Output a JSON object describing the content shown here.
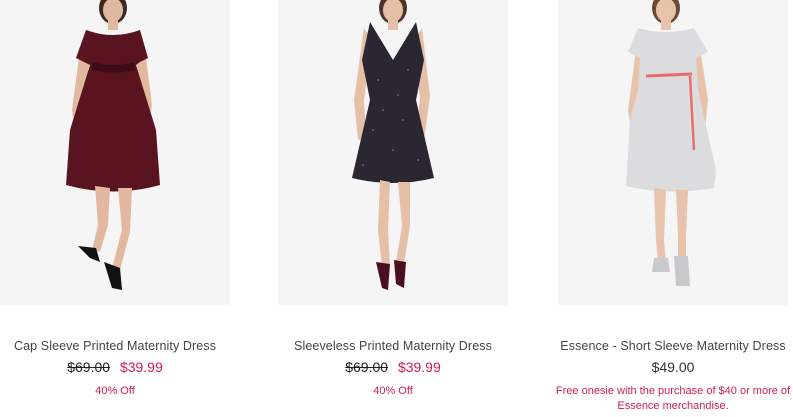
{
  "products": [
    {
      "name": "Cap Sleeve Printed Maternity Dress",
      "original_price": "$69.00",
      "sale_price": "$39.99",
      "promo": "40% Off",
      "dress_color": "#5a1420"
    },
    {
      "name": "Sleeveless Printed Maternity Dress",
      "original_price": "$69.00",
      "sale_price": "$39.99",
      "promo": "40% Off",
      "dress_color": "#2a2632"
    },
    {
      "name": "Essence - Short Sleeve Maternity Dress",
      "price": "$49.00",
      "promo": "Free onesie with the purchase of $40 or more of Essence merchandise.",
      "dress_color": "#dcdcdf"
    }
  ],
  "colors": {
    "sale": "#cc1f4f",
    "image_bg": "#f5f5f5"
  }
}
